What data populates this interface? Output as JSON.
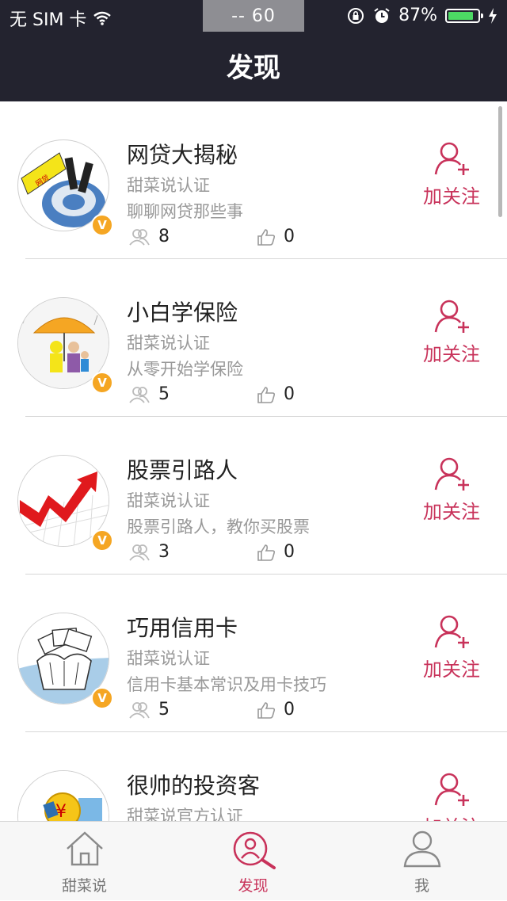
{
  "status_bar": {
    "carrier": "无 SIM 卡",
    "center": "--   60",
    "battery_percent": "87%",
    "battery_level": 0.87
  },
  "nav": {
    "title": "发现"
  },
  "colors": {
    "header_bg": "#23232f",
    "accent": "#c8325a",
    "badge": "#f5a623",
    "battery": "#4cd964"
  },
  "channels": [
    {
      "name": "网贷大揭秘",
      "certification": "甜菜说认证",
      "description": "聊聊网贷那些事",
      "fans": "8",
      "likes": "0",
      "follow_label": "加关注",
      "verified_mark": "V",
      "avatar_icon": "p2p-lending-avatar"
    },
    {
      "name": "小白学保险",
      "certification": "甜菜说认证",
      "description": "从零开始学保险",
      "fans": "5",
      "likes": "0",
      "follow_label": "加关注",
      "verified_mark": "V",
      "avatar_icon": "insurance-umbrella-avatar"
    },
    {
      "name": "股票引路人",
      "certification": "甜菜说认证",
      "description": "股票引路人，教你买股票",
      "fans": "3",
      "likes": "0",
      "follow_label": "加关注",
      "verified_mark": "V",
      "avatar_icon": "stock-arrow-avatar"
    },
    {
      "name": "巧用信用卡",
      "certification": "甜菜说认证",
      "description": "信用卡基本常识及用卡技巧",
      "fans": "5",
      "likes": "0",
      "follow_label": "加关注",
      "verified_mark": "V",
      "avatar_icon": "credit-cards-avatar"
    },
    {
      "name": "很帅的投资客",
      "certification": "甜菜说官方认证",
      "follow_label": "加关注",
      "avatar_icon": "coins-avatar"
    }
  ],
  "tabs": [
    {
      "label": "甜菜说",
      "icon": "home-icon",
      "active": false
    },
    {
      "label": "发现",
      "icon": "discover-icon",
      "active": true
    },
    {
      "label": "我",
      "icon": "profile-icon",
      "active": false
    }
  ]
}
